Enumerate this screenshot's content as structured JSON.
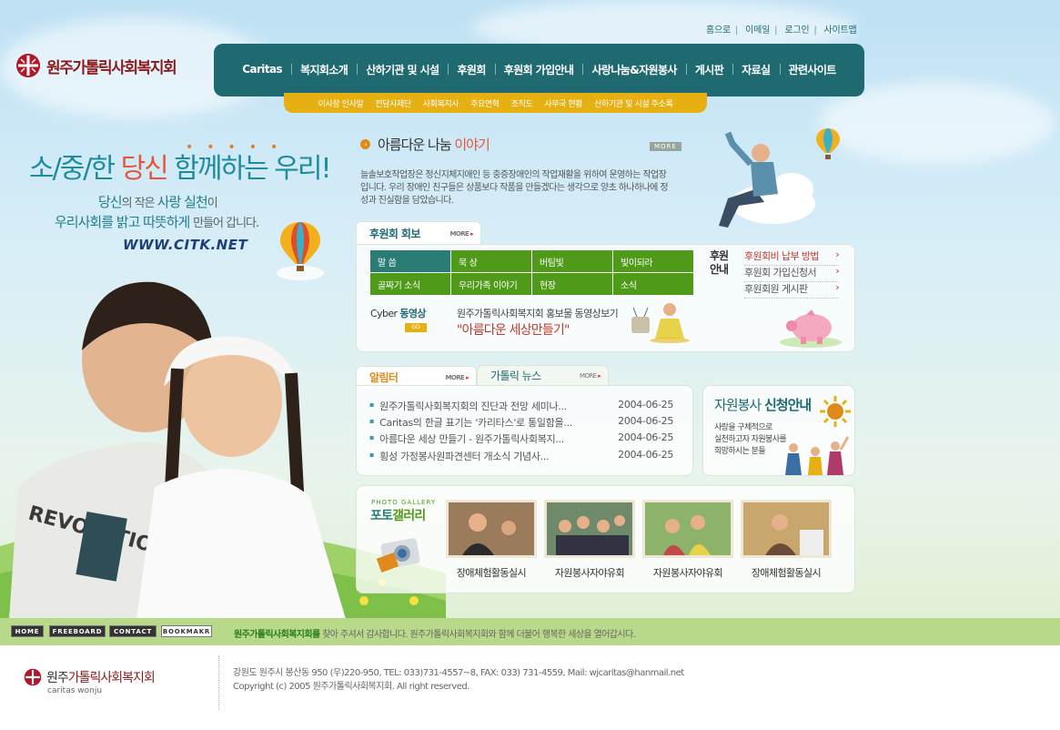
{
  "top_links": [
    "홈으로",
    "이메일",
    "로그인",
    "사이트맵"
  ],
  "logo": {
    "text": "원주가톨릭사회복지회",
    "brand_color": "#8b1a1a"
  },
  "main_nav": [
    "Caritas",
    "복지회소개",
    "산하기관 및 시설",
    "후원회",
    "후원회 가입안내",
    "사랑나눔&자원봉사",
    "게시판",
    "자료실",
    "관련사이트"
  ],
  "sub_nav": [
    "이사장 인사말",
    "전담사제단",
    "사회복지사",
    "주요연혁",
    "조직도",
    "사무국 현황",
    "산하기관 및 시설 주소록"
  ],
  "hero": {
    "slogan_a": "소/중/한 ",
    "slogan_em": "당신",
    "slogan_b": " 함께하는 우리!",
    "line1_a": "당신",
    "line1_b": "의 작은 ",
    "line1_c": "사랑 실천",
    "line1_d": "이",
    "line2_a": "우리사회를 밝고 따뜻하게 ",
    "line2_b": "만들어 갑니다.",
    "url": "WWW.CITK.NET"
  },
  "story": {
    "title_a": "아름다운 나눔 ",
    "title_b": "이야기",
    "more": "MORE",
    "text": "늘솔보호작업장은 정신지체지애인 등 중증장애인의 작업재활을 위하여 운영하는 작업장입니다. 우리 장애인 친구들은 상품보다 작품을 만들겠다는 생각으로 양초 하나하나에 정성과 진실함을 담았습니다."
  },
  "support_board": {
    "tab": "후원회 회보",
    "more": "MORE",
    "buttons": [
      "말 씀",
      "묵 상",
      "버팀빛",
      "빛이되라",
      "골짜기 소식",
      "우리가족 이야기",
      "현장",
      "소식"
    ],
    "side_title_1": "후원",
    "side_title_2": "안내",
    "side_links": [
      "후원회비 납부 방법",
      "후원회 가입신청서",
      "후원회원 게시판"
    ],
    "cyber_a": "Cyber ",
    "cyber_b": "동영상",
    "go": "GO",
    "promo_line1": "원주가톨릭사회복지회 홍보물 동영상보기",
    "promo_line2": "\"아름다운 세상만들기\""
  },
  "news": {
    "tab1": "알림터",
    "tab2": "가톨릭 뉴스",
    "more": "MORE",
    "items": [
      {
        "title": "원주가톨릭사회복지회의 진단과 전망 세미나...",
        "date": "2004-06-25"
      },
      {
        "title": "Caritas의 한글 표기는 '카리타스'로 통일함을...",
        "date": "2004-06-25"
      },
      {
        "title": "아름다운 세상 만들기 - 원주가톨릭사회복지...",
        "date": "2004-06-25"
      },
      {
        "title": "횡성 가정봉사원파견센터 개소식 기념사...",
        "date": "2004-06-25"
      }
    ]
  },
  "volunteer": {
    "title_a": "자원봉사 ",
    "title_b": "신청안내",
    "text": [
      "사랑을 구체적으로",
      "실천하고자 자원봉사를",
      "희망하시는 분들"
    ]
  },
  "gallery": {
    "label_en": "PHOTO GALLERY",
    "title_a": "포토",
    "title_b": "갤러리",
    "items": [
      "장애체험활동실시",
      "자원봉사자야유회",
      "자원봉사자야유회",
      "장애체험활동실시"
    ]
  },
  "footer": {
    "buttons": [
      "HOME",
      "FREEBOARD",
      "CONTACT",
      "BOOKMAKR"
    ],
    "msg_bold": "원주가톨릭사회복지회를",
    "msg": " 찾아 주셔서 감사합니다. 원주가톨릭사회복지회와 함께 더불어 행복한 세상을 열어갑시다.",
    "logo_a": "원주",
    "logo_b": "가톨릭사회복지회",
    "logo_sub": "caritas wonju",
    "address": "강원도 원주시 봉산동 950  (우)220-950, TEL: 033)731-4557~8, FAX: 033) 731-4559, Mail: wjcaritas@hanmail.net",
    "copyright": "Copyright (c) 2005 원주가톨릭사회복지회. All right reserved."
  },
  "colors": {
    "teal": "#1e6a70",
    "yellow": "#e7b012",
    "green": "#4f9b19",
    "accent": "#e4573b"
  }
}
